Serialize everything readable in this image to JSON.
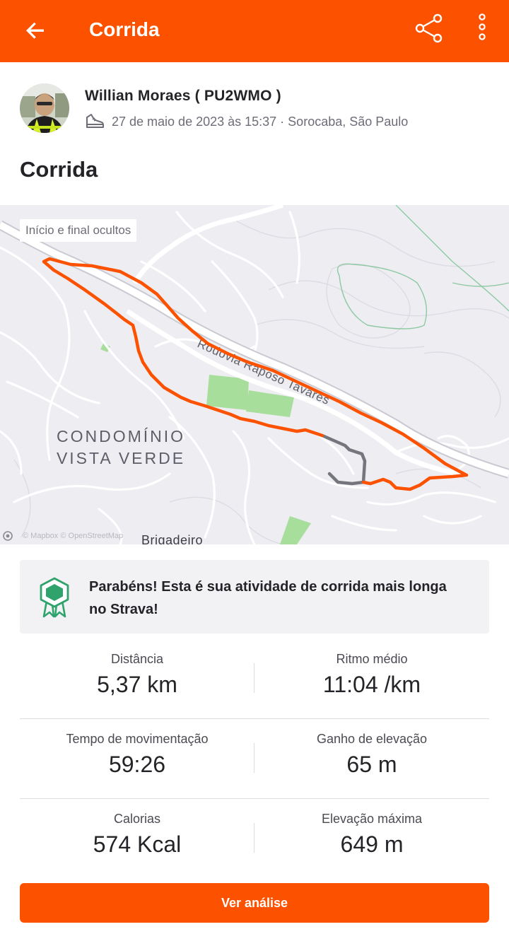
{
  "appbar": {
    "title": "Corrida",
    "back_icon": "arrow-left-icon",
    "share_icon": "share-icon",
    "more_icon": "more-vertical-icon"
  },
  "athlete": {
    "name": "Willian Moraes ( PU2WMO )",
    "activity_icon": "running-shoe-icon",
    "meta": "27 de maio de 2023 às 15:37 · Sorocaba, São Paulo"
  },
  "activity": {
    "title": "Corrida"
  },
  "map": {
    "privacy_label": "Início e final ocultos",
    "area_label": "CONDOMÍNIO VISTA VERDE",
    "road_label": "Rodovia Raposo Tavares",
    "place_label": "Brigadeiro",
    "attribution": "© Mapbox © OpenStreetMap",
    "route_color": "#fc5200",
    "hidden_route_color": "#75757d"
  },
  "achievement": {
    "icon": "achievement-medal-icon",
    "text": "Parabéns! Esta é sua atividade de corrida mais longa no Strava!"
  },
  "stats": {
    "rows": [
      [
        {
          "label": "Distância",
          "value": "5,37 km"
        },
        {
          "label": "Ritmo médio",
          "value": "11:04 /km"
        }
      ],
      [
        {
          "label": "Tempo de movimentação",
          "value": "59:26"
        },
        {
          "label": "Ganho de elevação",
          "value": "65 m"
        }
      ],
      [
        {
          "label": "Calorias",
          "value": "574 Kcal"
        },
        {
          "label": "Elevação máxima",
          "value": "649 m"
        }
      ]
    ]
  },
  "cta": {
    "label": "Ver análise"
  },
  "colors": {
    "brand": "#fc5200",
    "achievement_green": "#2fa36b"
  }
}
